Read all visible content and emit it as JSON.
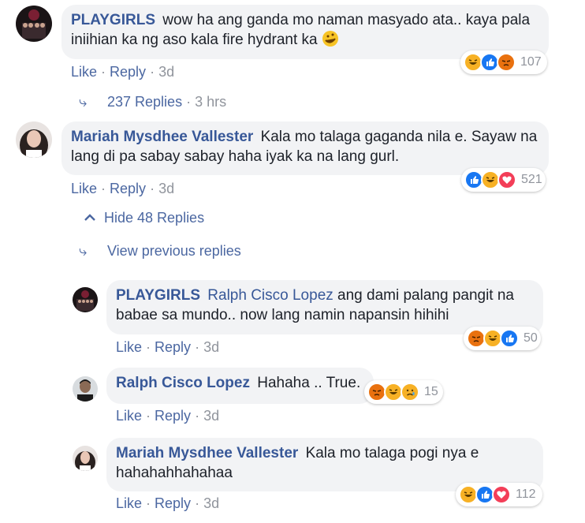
{
  "comments": [
    {
      "author": "PLAYGIRLS",
      "mention": "",
      "text": "wow ha ang ganda mo naman masyado ata.. kaya pala iniihian ka ng aso kala fire hydrant ka",
      "like": "Like",
      "reply": "Reply",
      "time": "3d",
      "reaction_count": "107",
      "reactions": [
        "haha-icon",
        "like-icon",
        "angry-icon"
      ]
    },
    {
      "author": "Mariah Mysdhee Vallester",
      "mention": "",
      "text": "Kala mo talaga gaganda nila e. Sayaw na lang di pa sabay sabay haha iyak ka na lang gurl.",
      "like": "Like",
      "reply": "Reply",
      "time": "3d",
      "reaction_count": "521",
      "reactions": [
        "like-icon",
        "haha-icon",
        "love-icon"
      ]
    }
  ],
  "replies_link": {
    "label": "237 Replies",
    "time": "3 hrs"
  },
  "hide_replies": {
    "label": "Hide 48 Replies"
  },
  "view_previous": {
    "label": "View previous replies"
  },
  "replies": [
    {
      "author": "PLAYGIRLS",
      "mention": "Ralph Cisco Lopez",
      "text": "ang dami palang pangit na babae sa mundo.. now lang namin napansin hihihi",
      "like": "Like",
      "reply": "Reply",
      "time": "3d",
      "reaction_count": "50",
      "reactions": [
        "angry-icon",
        "haha-icon",
        "like-icon"
      ]
    },
    {
      "author": "Ralph Cisco Lopez",
      "mention": "",
      "text": "Hahaha .. True.",
      "like": "Like",
      "reply": "Reply",
      "time": "3d",
      "reaction_count": "15",
      "reactions": [
        "angry-icon",
        "haha-icon",
        "sad-icon"
      ]
    },
    {
      "author": "Mariah Mysdhee Vallester",
      "mention": "",
      "text": "Kala mo talaga pogi nya e hahahahhahahaa",
      "like": "Like",
      "reply": "Reply",
      "time": "3d",
      "reaction_count": "112",
      "reactions": [
        "haha-icon",
        "like-icon",
        "love-icon"
      ]
    }
  ],
  "colors": {
    "link": "#385898",
    "muted": "#90949c",
    "bubble": "#f2f3f5",
    "like": "#1877f2",
    "love": "#f33e58",
    "haha": "#f7b125",
    "angry": "#e9710f"
  }
}
